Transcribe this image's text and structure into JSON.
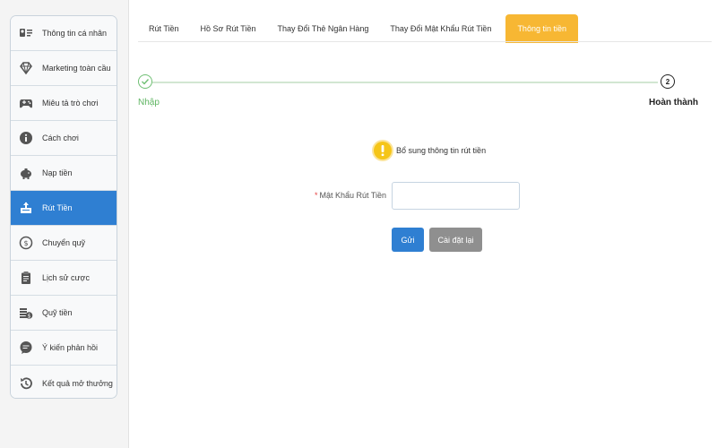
{
  "sidebar": {
    "items": [
      {
        "label": "Thông tin cá nhân",
        "icon": "profile-card-icon"
      },
      {
        "label": "Marketing toàn cầu",
        "icon": "diamond-icon"
      },
      {
        "label": "Miêu tả trò chơi",
        "icon": "gamepad-icon"
      },
      {
        "label": "Cách chơi",
        "icon": "info-icon"
      },
      {
        "label": "Nạp tiền",
        "icon": "piggy-bank-icon"
      },
      {
        "label": "Rút Tiền",
        "icon": "withdraw-icon",
        "active": true
      },
      {
        "label": "Chuyển quỹ",
        "icon": "transfer-icon"
      },
      {
        "label": "Lịch sử cược",
        "icon": "clipboard-icon"
      },
      {
        "label": "Quỹ tiền",
        "icon": "coins-icon"
      },
      {
        "label": "Ý kiến phản hồi",
        "icon": "chat-bubble-icon"
      },
      {
        "label": "Kết quả mở thưởng",
        "icon": "history-icon"
      }
    ]
  },
  "tabs": [
    {
      "label": "Rút Tiền"
    },
    {
      "label": "Hồ Sơ Rút Tiền"
    },
    {
      "label": "Thay Đổi Thẻ Ngân Hàng"
    },
    {
      "label": "Thay Đổi Mật Khẩu Rút Tiền"
    },
    {
      "label": "Thông tin tiền",
      "active": true
    }
  ],
  "steps": {
    "step1_label": "Nhập",
    "step2_number": "2",
    "step2_label": "Hoàn thành"
  },
  "notice": {
    "text": "Bổ sung thông tin rút tiền"
  },
  "form": {
    "required_mark": "*",
    "password_label": "Mật Khẩu Rút Tiền",
    "password_value": "",
    "submit_label": "Gửi",
    "reset_label": "Cài đặt lại"
  },
  "colors": {
    "active_blue": "#2f7fd2",
    "tab_orange": "#f7b733",
    "step_green": "#5fb562",
    "warning_yellow": "#f5c518",
    "reset_gray": "#8f8f8f"
  }
}
